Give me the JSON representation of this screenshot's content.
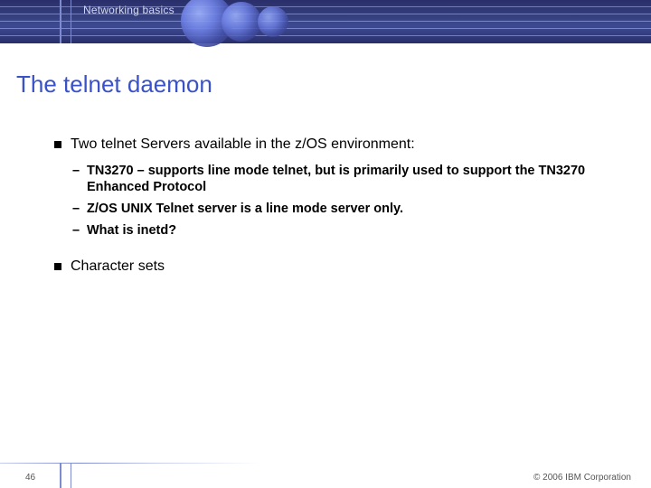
{
  "header": {
    "section": "Networking basics"
  },
  "title": "The telnet daemon",
  "points": [
    {
      "text": "Two telnet Servers available in the z/OS environment:",
      "subs": [
        "TN3270 – supports line mode telnet, but is primarily used to support the TN3270 Enhanced Protocol",
        "Z/OS UNIX Telnet server is a line mode server only.",
        "What is inetd?"
      ]
    },
    {
      "text": "Character sets",
      "subs": []
    }
  ],
  "footer": {
    "pageNumber": "46",
    "copyright": "© 2006 IBM Corporation"
  }
}
